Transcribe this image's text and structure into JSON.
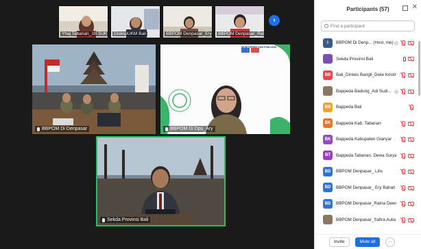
{
  "thumbnails": [
    {
      "name": "Yhaj Tabanan_1B SUK"
    },
    {
      "name": "DiskopUKM Bali"
    },
    {
      "name": "BBPOM Denpasar_Ery..."
    },
    {
      "name": "BBPOM Denpasar_Rat..."
    }
  ],
  "tiles": {
    "a": {
      "name": "BBPOM Di Denpasar"
    },
    "b": {
      "name": "BBPOM Di Dps_Ary",
      "banner": "MONITORING DAN EVALUASI"
    },
    "c": {
      "name": "Sekda Provinsi Bali"
    }
  },
  "panel": {
    "title": "Participants (57)",
    "search_placeholder": "Find a participant",
    "participants": [
      {
        "initials": "I",
        "color": "#3a5a8c",
        "name": "BBPOM Di Denp... (Host, me)"
      },
      {
        "initials": "",
        "color": "#7a4fb0",
        "name": "Sekda Provinsi Bali"
      },
      {
        "initials": "BB",
        "color": "#e5484d",
        "name": "Bali_Dinkes Bangli_Dwie Kristina"
      },
      {
        "initials": "",
        "color": "#8a7766",
        "name": "Bappeda Badung_Adi Sudi..."
      },
      {
        "initials": "BB",
        "color": "#f0a12c",
        "name": "Bappeda Bali"
      },
      {
        "initials": "BK",
        "color": "#e8742e",
        "name": "Bappeda Kab. Tabanan"
      },
      {
        "initials": "BK",
        "color": "#8e4fc2",
        "name": "Bappeda Kabupaten Gianyar"
      },
      {
        "initials": "BT",
        "color": "#9e3fb8",
        "name": "Bappeda Tabanan, Dewa Surya"
      },
      {
        "initials": "BD",
        "color": "#2f74d0",
        "name": "BBPOM Denpasar_ Liiis"
      },
      {
        "initials": "BD",
        "color": "#2f74d0",
        "name": "BBPOM Denpasar_ Ery Bahari"
      },
      {
        "initials": "BD",
        "color": "#2f74d0",
        "name": "BBPOM Denpasar_Ratna Dewi"
      },
      {
        "initials": "",
        "color": "#8a7766",
        "name": "BBPOM Denpasar_Safira Aulia"
      }
    ],
    "invite_label": "Invite",
    "mute_all_label": "Mute all",
    "more_label": "···",
    "next_label": "›"
  }
}
